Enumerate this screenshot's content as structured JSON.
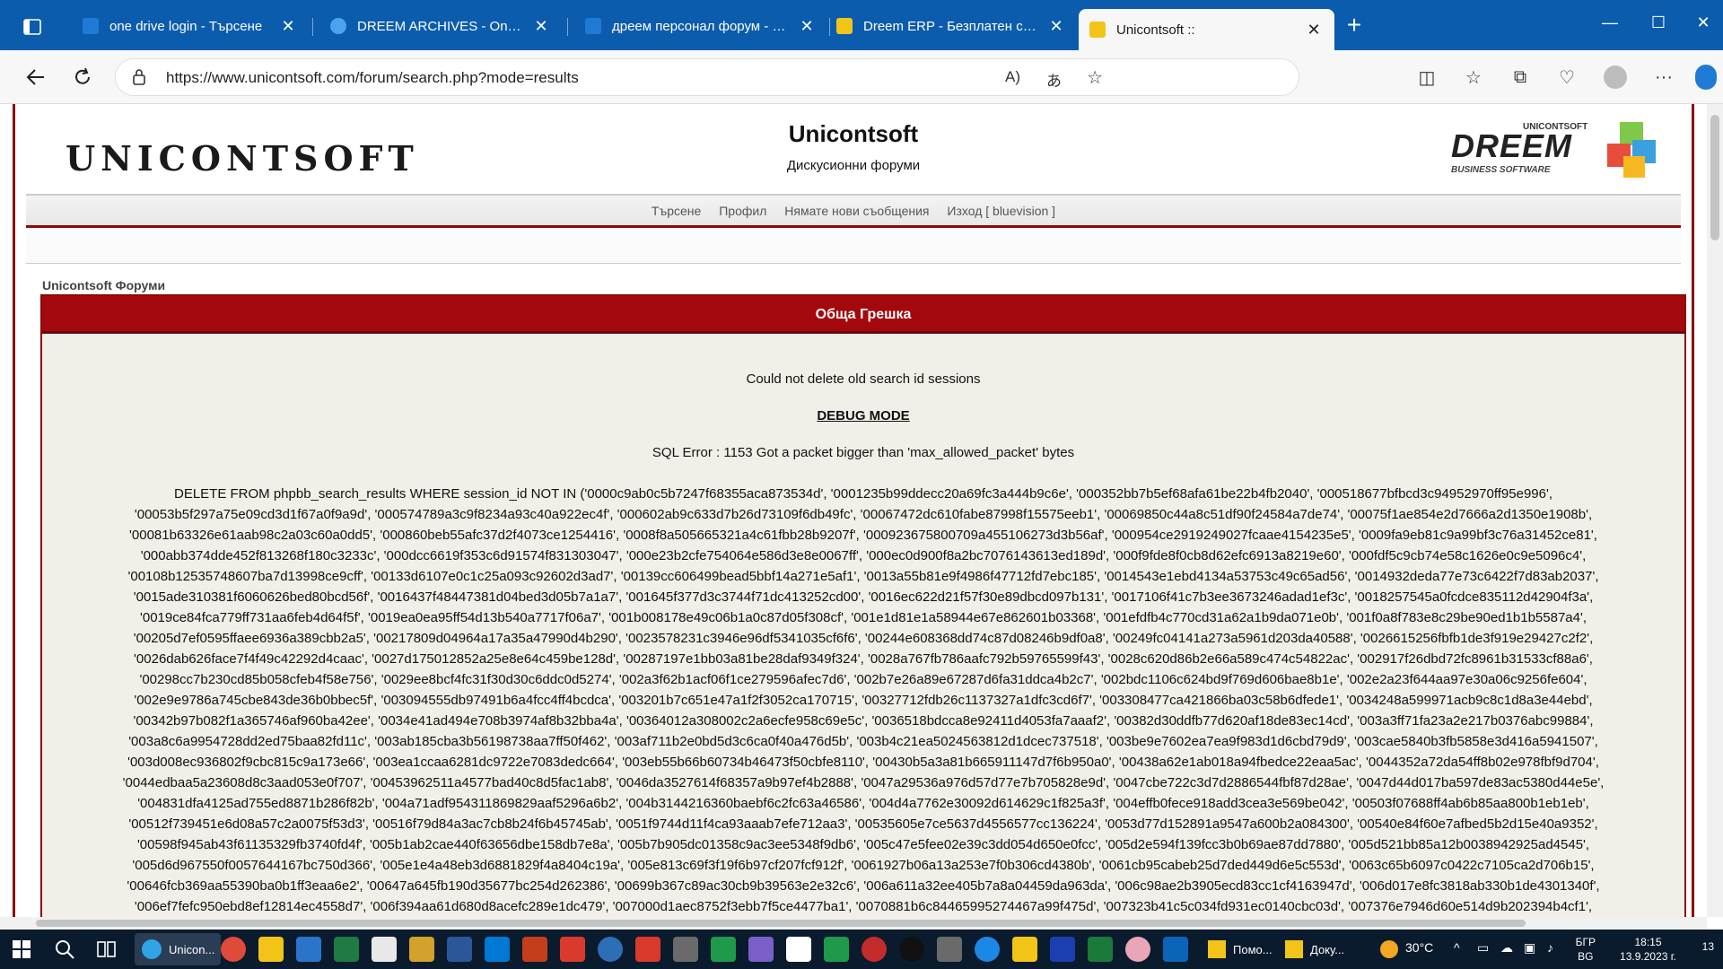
{
  "browser": {
    "tabs": [
      {
        "title": "one drive login - Търсене",
        "active": false,
        "icon": "search-icon"
      },
      {
        "title": "DREEM ARCHIVES - OneDrive",
        "active": false,
        "icon": "onedrive-icon"
      },
      {
        "title": "дреем персонал форум - Търсе",
        "active": false,
        "icon": "search-icon"
      },
      {
        "title": "Dreem ERP - Безплатен складо",
        "active": false,
        "icon": "dreem-icon"
      },
      {
        "title": "Unicontsoft ::",
        "active": true,
        "icon": "dreem-icon"
      }
    ],
    "url": "https://www.unicontsoft.com/forum/search.php?mode=results",
    "colors": {
      "titlebar": "#0b5cad",
      "accent": "#a3080d"
    }
  },
  "forum": {
    "logo_text": "UNICONTSOFT",
    "site_title": "Unicontsoft",
    "site_description": "Дискусионни форуми",
    "right_logo": {
      "small": "UNICONTSOFT",
      "main": "DREEM",
      "sub": "BUSINESS SOFTWARE"
    },
    "nav": [
      "Търсене",
      "Профил",
      "Нямате нови съобщения",
      "Изход [ bluevision ]"
    ],
    "breadcrumb": "Unicontsoft Форуми",
    "error": {
      "header": "Обща Грешка",
      "message": "Could not delete old search id sessions",
      "debug_label": "DEBUG MODE",
      "sql_error": "SQL Error : 1153 Got a packet bigger than 'max_allowed_packet' bytes",
      "sql_lines": [
        "DELETE FROM phpbb_search_results WHERE session_id NOT IN ('0000c9ab0c5b7247f68355aca873534d', '0001235b99ddecc20a69fc3a444b9c6e', '000352bb7b5ef68afa61be22b4fb2040', '000518677bfbcd3c94952970ff95e996',",
        "'00053b5f297a75e09cd3d1f67a0f9a9d', '000574789a3c9f8234a93c40a922ec4f', '000602ab9c633d7b26d73109f6db49fc', '00067472dc610fabe87998f15575eeb1', '00069850c44a8c51df90f24584a7de74', '00075f1ae854e2d7666a2d1350e1908b',",
        "'00081b63326e61aab98c2a03c60a0dd5', '000860beb55afc37d2f4073ce1254416', '0008f8a505665321a4c61fbb28b9207f', '000923675800709a455106273d3b56af', '000954ce2919249027fcaae4154235e5', '0009fa9eb81c9a99bf3c76a31452ce81',",
        "'000abb374dde452f813268f180c3233c', '000dcc6619f353c6d91574f831303047', '000e23b2cfe754064e586d3e8e0067ff', '000ec0d900f8a2bc7076143613ed189d', '000f9fde8f0cb8d62efc6913a8219e60', '000fdf5c9cb74e58c1626e0c9e5096c4',",
        "'00108b12535748607ba7d13998ce9cff', '00133d6107e0c1c25a093c92602d3ad7', '00139cc606499bead5bbf14a271e5af1', '0013a55b81e9f4986f47712fd7ebc185', '0014543e1ebd4134a53753c49c65ad56', '0014932deda77e73c6422f7d83ab2037',",
        "'0015ade310381f6060626bed80bcd56f', '0016437f48447381d04bed3d05b7a1a7', '001645f377d3c3744f71dc413252cd00', '0016ec622d21f57f30e89dbcd097b131', '0017106f41c7b3ee3673246adad1ef3c', '0018257545a0fcdce835112d42904f3a',",
        "'0019ce84fca779ff731aa6feb4d64f5f', '0019ea0ea95ff54d13b540a7717f06a7', '001b008178e49c06b1a0c87d05f308cf', '001e1d81e1a58944e67e862601b03368', '001efdfb4c770cd31a62a1b9da071e0b', '001f0a8f783e8c29be90ed1b1b5587a4',",
        "'00205d7ef0595ffaee6936a389cbb2a5', '00217809d04964a17a35a47990d4b290', '0023578231c3946e96df5341035cf6f6', '00244e608368dd74c87d08246b9df0a8', '00249fc04141a273a5961d203da40588', '0026615256fbfb1de3f919e29427c2f2',",
        "'0026dab626face7f4f49c42292d4caac', '0027d175012852a25e8e64c459be128d', '00287197e1bb03a81be28daf9349f324', '0028a767fb786aafc792b59765599f43', '0028c620d86b2e66a589c474c54822ac', '002917f26dbd72fc8961b31533cf88a6',",
        "'00298cc7b230cd85b058cfeb4f58e756', '0029ee8bcf4fc31f30d30c6ddc0d5274', '002a3f62b1acf06f1ce279596afec7d6', '002b7e26a89e67287d6fa31ddca4b2c7', '002bdc1106c624bd9f769d606bae8b1e', '002e2a23f644aa97e30a06c9256fe604',",
        "'002e9e9786a745cbe843de36b0bbec5f', '003094555db97491b6a4fcc4ff4bcdca', '003201b7c651e47a1f2f3052ca170715', '00327712fdb26c1137327a1dfc3cd6f7', '003308477ca421866ba03c58b6dfede1', '0034248a599971acb9c8c1d8a3e44ebd',",
        "'00342b97b082f1a365746af960ba42ee', '0034e41ad494e708b3974af8b32bba4a', '00364012a308002c2a6ecfe958c69e5c', '0036518bdcca8e92411d4053fa7aaaf2', '00382d30ddfb77d620af18de83ec14cd', '003a3ff71fa23a2e217b0376abc99884',",
        "'003a8c6a9954728dd2ed75baa82fd11c', '003ab185cba3b56198738aa7ff50f462', '003af711b2e0bd5d3c6ca0f40a476d5b', '003b4c21ea5024563812d1dcec737518', '003be9e7602ea7ea9f983d1d6cbd79d9', '003cae5840b3fb5858e3d416a5941507',",
        "'003d008ec936802f9cbc815c9a173e66', '003ea1ccaa6281dc9722e7083dedc664', '003eb55b66b60734b46473f50cbfe8110', '00430b5a3a81b665911147d7f6b950a0', '00438a62e1ab018a94fbedce22eaa5ac', '0044352a72da54ff8b02e978fbf9d704',",
        "'0044edbaa5a23608d8c3aad053e0f707', '00453962511a4577bad40c8d5fac1ab8', '0046da3527614f68357a9b97ef4b2888', '0047a29536a976d57d77e7b705828e9d', '0047cbe722c3d7d2886544fbf87d28ae', '0047d44d017ba597de83ac5380d44e5e',",
        "'004831dfa4125ad755ed8871b286f82b', '004a71adf954311869829aaf5296a6b2', '004b3144216360baebf6c2fc63a46586', '004d4a7762e30092d614629c1f825a3f', '004effb0fece918add3cea3e569be042', '00503f07688ff4ab6b85aa800b1eb1eb',",
        "'00512f739451e6d08a57c2a0075f53d3', '00516f79d84a3ac7cb8b24f6b45745ab', '0051f9744d11f4ca93aaab7efe712aa3', '00535605e7ce5637d4556577cc136224', '0053d77d152891a9547a600b2a084300', '00540e84f60e7afbed5b2d15e40a9352',",
        "'00598f945ab43f61135329fb3740fd4f', '005b1ab2cae440f63656dbe158db7e8a', '005b7b905dc01358c9ac3ee5348f9db6', '005c47e5fee02e39c3dd054d650e0fcc', '005d2e594f139fcc3b0b69ae87dd7880', '005d521bb85a12b0038942925ad4545',",
        "'005d6d967550f0057644167bc750d366', '005e1e4a48eb3d6881829f4a8404c19a', '005e813c69f3f19f6b97cf207fcf912f', '0061927b06a13a253e7f0b306cd4380b', '0061cb95cabeb25d7ded449d6e5c553d', '0063c65b6097c0422c7105ca2d706b15',",
        "'00646fcb369aa55390ba0b1ff3eaa6e2', '00647a645fb190d35677bc254d262386', '00699b367c89ac30cb9b39563e2e32c6', '006a611a32ee405b7a8a04459da963da', '006c98ae2b3905ecd83cc1cf4163947d', '006d017e8fc3818ab330b1de4301340f',",
        "'006ef7fefc950ebd8ef12814ec4558d7', '006f394aa61d680d8acefc289e1dc479', '007000d1aec8752f3ebb7f5ce4477ba1', '0070881b6c84465995274467a99f475d', '007323b41c5c034fd931ec0140cbc03d', '007376e7946d60e514d9b202394b4cf1',"
      ]
    }
  },
  "taskbar": {
    "active_app": "Unicon...",
    "apps": [
      "Помо...",
      "Доку..."
    ],
    "weather": "30°C",
    "lang": [
      "БГР",
      "BG"
    ],
    "time": "18:15",
    "date": "13.9.2023 г.",
    "notifications": "13"
  }
}
